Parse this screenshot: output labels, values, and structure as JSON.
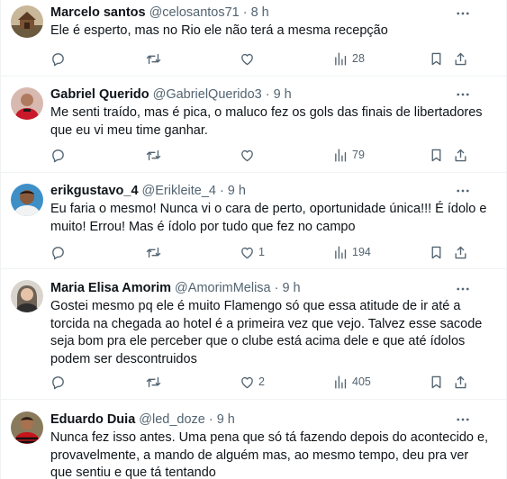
{
  "colors": {
    "text": "#0f1419",
    "secondary": "#536471",
    "divider": "#eff3f4",
    "background": "#ffffff"
  },
  "tweets": [
    {
      "name": "Marcelo santos",
      "handle": "@celosantos71",
      "separator": "·",
      "time": "8 h",
      "lines": [
        "Ele é esperto, mas no Rio ele não terá a mesma recepção"
      ],
      "likes": "",
      "views": "28",
      "avatar": "wooden-hut-avatar"
    },
    {
      "name": "Gabriel Querido",
      "handle": "@GabrielQuerido3",
      "separator": "·",
      "time": "9 h",
      "lines": [
        "Me senti traído, mas é pica, o maluco fez os gols das finais de libertadores",
        "que eu vi meu time ganhar."
      ],
      "likes": "",
      "views": "79",
      "avatar": "red-jersey-avatar"
    },
    {
      "name": "erikgustavo_4",
      "handle": "@Erikleite_4",
      "separator": "·",
      "time": "9 h",
      "lines": [
        "Eu faria o mesmo! Nunca vi o cara de perto, oportunidade única!!! É ídolo e",
        "muito! Errou! Mas é ídolo por tudo que fez no campo"
      ],
      "likes": "1",
      "views": "194",
      "avatar": "man-portrait-avatar"
    },
    {
      "name": "Maria Elisa Amorim",
      "handle": "@AmorimMelisa",
      "separator": "·",
      "time": "9 h",
      "lines": [
        "Gostei mesmo pq ele é muito Flamengo só que essa atitude de ir até a",
        "torcida na chegada ao hotel é a primeira vez que vejo. Talvez esse sacode",
        "seja bom pra ele perceber que o clube está acima dele e que até ídolos",
        "podem ser descontruidos"
      ],
      "likes": "2",
      "views": "405",
      "avatar": "woman-portrait-avatar"
    },
    {
      "name": "Eduardo Duia",
      "handle": "@led_doze",
      "separator": "·",
      "time": "9 h",
      "lines": [
        "Nunca fez isso antes. Uma pena que só tá fazendo depois do acontecido e,",
        "provavelmente, a mando de alguém mas, ao mesmo tempo, deu pra ver",
        "que sentiu e que tá tentando"
      ],
      "likes": "",
      "views": "",
      "avatar": "flamengo-shirt-avatar"
    }
  ]
}
